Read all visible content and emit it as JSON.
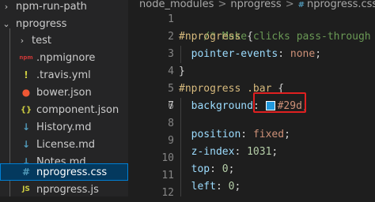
{
  "explorer": {
    "items": [
      {
        "label": "npm-run-path",
        "kind": "folder",
        "expanded": false
      },
      {
        "label": "nprogress",
        "kind": "folder",
        "expanded": true
      },
      {
        "label": "test",
        "kind": "folder",
        "expanded": false
      },
      {
        "label": ".npmignore",
        "kind": "npm",
        "icon_text": "npm"
      },
      {
        "label": ".travis.yml",
        "kind": "yml",
        "icon_text": "!"
      },
      {
        "label": "bower.json",
        "kind": "bower",
        "icon_text": "●"
      },
      {
        "label": "component.json",
        "kind": "json",
        "icon_text": "{}"
      },
      {
        "label": "History.md",
        "kind": "md",
        "icon_text": "↓"
      },
      {
        "label": "License.md",
        "kind": "md",
        "icon_text": "↓"
      },
      {
        "label": "Notes.md",
        "kind": "md",
        "icon_text": "↓"
      },
      {
        "label": "nprogress.css",
        "kind": "css",
        "icon_text": "#",
        "selected": true
      },
      {
        "label": "nprogress.js",
        "kind": "js",
        "icon_text": "JS"
      }
    ]
  },
  "breadcrumb": {
    "parts": [
      "node_modules",
      "nprogress",
      "nprogress.css"
    ],
    "css_icon": "#",
    "separator": ">"
  },
  "editor": {
    "line_numbers": [
      "1",
      "2",
      "3",
      "4",
      "5",
      "6",
      "7",
      "8",
      "9",
      "10",
      "11",
      "12"
    ],
    "current_line": "7",
    "lines": {
      "l1_comment": "/* Make clicks pass-through */",
      "l2_selector": "#nprogress",
      "l2_brace": " {",
      "l3_prop": "pointer-events",
      "l3_colon": ": ",
      "l3_value": "none",
      "l3_semi": ";",
      "l4_brace": "}",
      "l6_selector": "#nprogress .bar",
      "l6_brace": " {",
      "l7_prop": "background",
      "l7_colon": ": ",
      "l7_value": "#29d",
      "l7_semi": ";",
      "l9_prop": "position",
      "l9_colon": ": ",
      "l9_value": "fixed",
      "l9_semi": ";",
      "l10_prop": "z-index",
      "l10_colon": ": ",
      "l10_value": "1031",
      "l10_semi": ";",
      "l11_prop": "top",
      "l11_colon": ": ",
      "l11_value": "0",
      "l11_semi": ";",
      "l12_prop": "left",
      "l12_colon": ": ",
      "l12_value": "0",
      "l12_semi": ";"
    },
    "color_swatch": "#2299dd"
  },
  "colors": {
    "accent_highlight": "#e02020",
    "selection": "#04395e",
    "npm": "#cb3837",
    "yml": "#cbcb41",
    "bower": "#ef5734",
    "json": "#cbcb41",
    "md": "#519aba",
    "css": "#519aba",
    "js": "#cbcb41"
  }
}
